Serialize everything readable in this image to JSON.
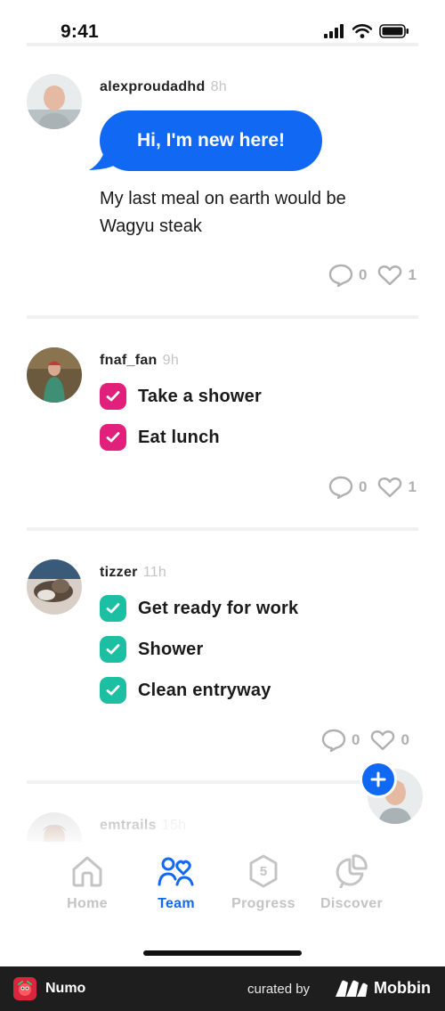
{
  "status_bar": {
    "time": "9:41"
  },
  "peek_reactions": {
    "comments": "0",
    "likes": "1"
  },
  "posts": [
    {
      "username": "alexproudadhd",
      "time": "8h",
      "bubble": "Hi, I'm new here!",
      "text": "My last meal on earth would be Wagyu steak",
      "comments": "0",
      "likes": "1"
    },
    {
      "username": "fnaf_fan",
      "time": "9h",
      "tasks": [
        "Take a shower",
        "Eat lunch"
      ],
      "comments": "0",
      "likes": "1"
    },
    {
      "username": "tizzer",
      "time": "11h",
      "tasks": [
        "Get ready for work",
        "Shower",
        "Clean entryway"
      ],
      "comments": "0",
      "likes": "0"
    },
    {
      "username": "emtrails",
      "time": "15h"
    }
  ],
  "tabs": [
    {
      "label": "Home",
      "icon": "home-icon"
    },
    {
      "label": "Team",
      "icon": "team-icon"
    },
    {
      "label": "Progress",
      "icon": "progress-icon",
      "badge": "5"
    },
    {
      "label": "Discover",
      "icon": "discover-icon"
    }
  ],
  "active_tab": "Team",
  "footer": {
    "app_name": "Numo",
    "curated_by": "curated by",
    "brand": "Mobbin"
  },
  "colors": {
    "accent": "#1168f2",
    "pink_check": "#e0207a",
    "teal_check": "#1cbfa1"
  }
}
